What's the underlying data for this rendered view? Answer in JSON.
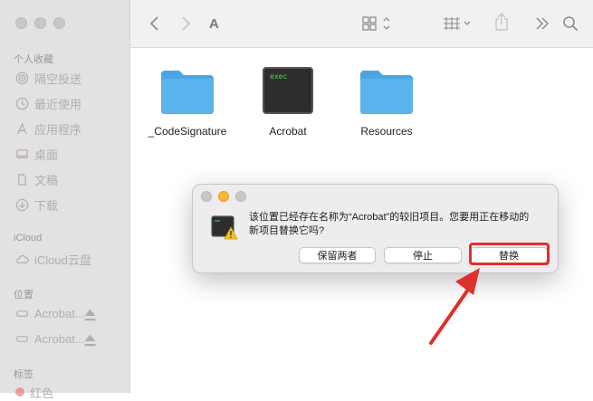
{
  "sidebar": {
    "favorites_title": "个人收藏",
    "favorites": [
      {
        "label": "隔空投送",
        "icon": "airdrop-icon"
      },
      {
        "label": "最近使用",
        "icon": "clock-icon"
      },
      {
        "label": "应用程序",
        "icon": "applications-icon"
      },
      {
        "label": "桌面",
        "icon": "desktop-icon"
      },
      {
        "label": "文稿",
        "icon": "document-icon"
      },
      {
        "label": "下载",
        "icon": "download-icon"
      }
    ],
    "icloud_title": "iCloud",
    "icloud": [
      {
        "label": "iCloud云盘",
        "icon": "cloud-icon"
      }
    ],
    "locations_title": "位置",
    "locations": [
      {
        "label": "Acrobat...",
        "icon": "disk-icon"
      },
      {
        "label": "Acrobat...",
        "icon": "disk-icon"
      }
    ],
    "tags_title": "标签",
    "tags": [
      {
        "label": "红色",
        "color": "#e5534b"
      }
    ]
  },
  "toolbar": {
    "title": "A",
    "back_icon": "chevron-left-icon",
    "forward_icon": "chevron-right-icon",
    "view_icon": "grid-view-icon",
    "group_icon": "group-icon",
    "share_icon": "share-icon",
    "more_icon": "double-chevron-icon",
    "search_icon": "search-icon"
  },
  "files": [
    {
      "label": "_CodeSignature",
      "icon": "folder-icon"
    },
    {
      "label": "Acrobat",
      "icon": "exec-icon",
      "badge": "exec"
    },
    {
      "label": "Resources",
      "icon": "folder-icon"
    }
  ],
  "dialog": {
    "message_line1": "该位置已经存在名称为“Acrobat”的较旧项目。您要用正在移动的",
    "message_line2": "新项目替换它吗?",
    "buttons": {
      "keep_both": "保留两者",
      "stop": "停止",
      "replace": "替换"
    },
    "dot_colors": [
      "#c9c6c9",
      "#f5b73a",
      "#c9c6c9"
    ]
  },
  "colors": {
    "folder": "#5ab3ec",
    "annotation": "#e0302e"
  }
}
